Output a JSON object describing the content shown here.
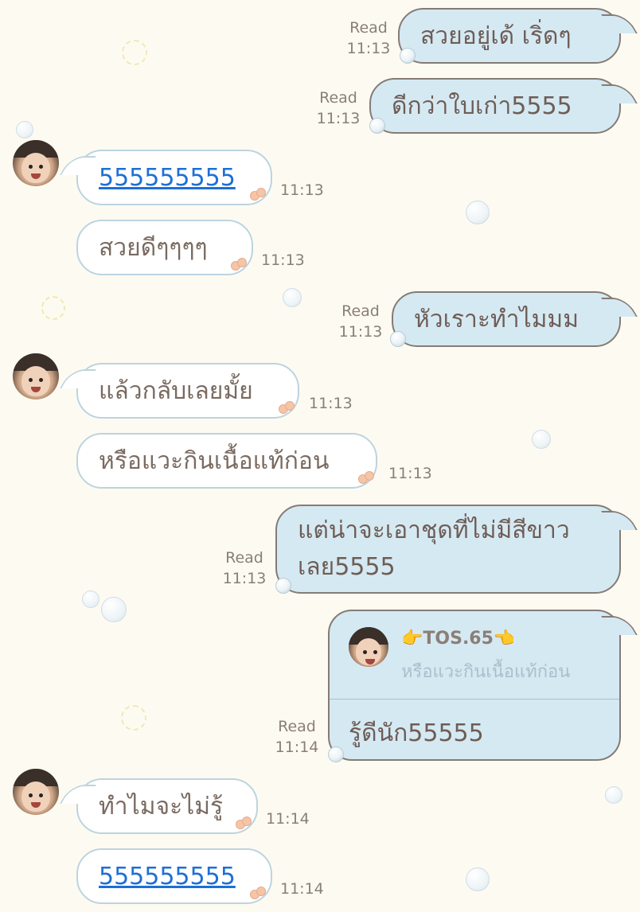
{
  "messages": [
    {
      "side": "out",
      "text": "สวยอยู่เด้ เริ่ดๆ",
      "status": "Read",
      "time": "11:13"
    },
    {
      "side": "out",
      "text": "ดีกว่าใบเก่า5555",
      "status": "Read",
      "time": "11:13"
    },
    {
      "side": "in",
      "text": "555555555",
      "is_link": true,
      "time": "11:13"
    },
    {
      "side": "in",
      "text": "สวยดีๆๆๆๆ",
      "time": "11:13"
    },
    {
      "side": "out",
      "text": "หัวเราะทำไมมม",
      "status": "Read",
      "time": "11:13"
    },
    {
      "side": "in",
      "text": "แล้วกลับเลยมั้ย",
      "time": "11:13"
    },
    {
      "side": "in",
      "text": "หรือแวะกินเนื้อแท้ก่อน",
      "time": "11:13"
    },
    {
      "side": "out",
      "text_line1": "แต่น่าจะเอาชุดที่ไม่มีสีขาว",
      "text_line2": "เลย5555",
      "status": "Read",
      "time": "11:13"
    },
    {
      "side": "out",
      "reply_name": "👉TOS.65👈",
      "reply_quote": "หรือแวะกินเนื้อแท้ก่อน",
      "text": "รู้ดีนัก55555",
      "status": "Read",
      "time": "11:14"
    },
    {
      "side": "in",
      "text": "ทำไมจะไม่รู้",
      "time": "11:14"
    },
    {
      "side": "in",
      "text": "555555555",
      "is_link": true,
      "time": "11:14"
    }
  ],
  "colors": {
    "background": "#fdfbf1",
    "incoming_bubble": "#ffffff",
    "outgoing_bubble": "#d5e9f3",
    "link": "#1d6fd6",
    "meta_text": "#8a7f76"
  }
}
